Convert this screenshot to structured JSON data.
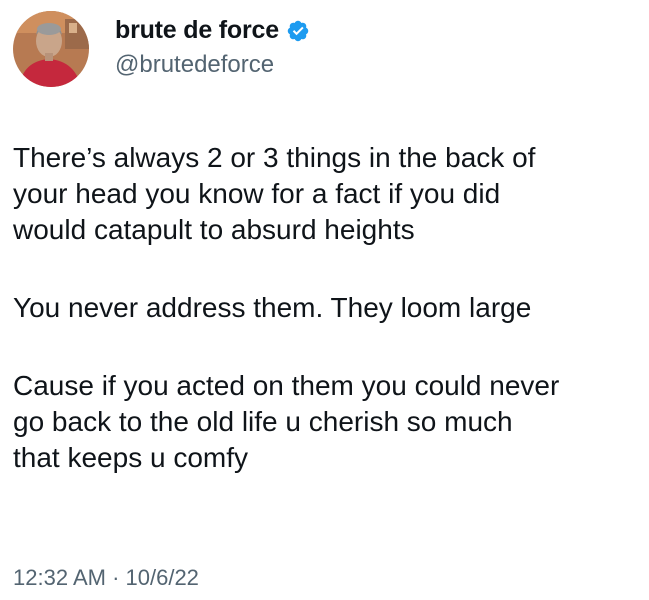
{
  "author": {
    "display_name": "brute de force",
    "handle": "@brutedeforce",
    "verified": true,
    "verified_color": "#1d9bf0",
    "avatar_icon": "profile-photo"
  },
  "tweet": {
    "paragraphs": [
      "There’s always 2 or 3 things in the back of\nyour head you know for a fact if you did\nwould catapult to absurd heights",
      "You never address them.  They loom large",
      "Cause if you acted on them you could never\ngo back to the old life u cherish so much\nthat keeps u comfy"
    ]
  },
  "meta": {
    "time": "12:32 AM",
    "separator": " · ",
    "date": "10/6/22"
  }
}
